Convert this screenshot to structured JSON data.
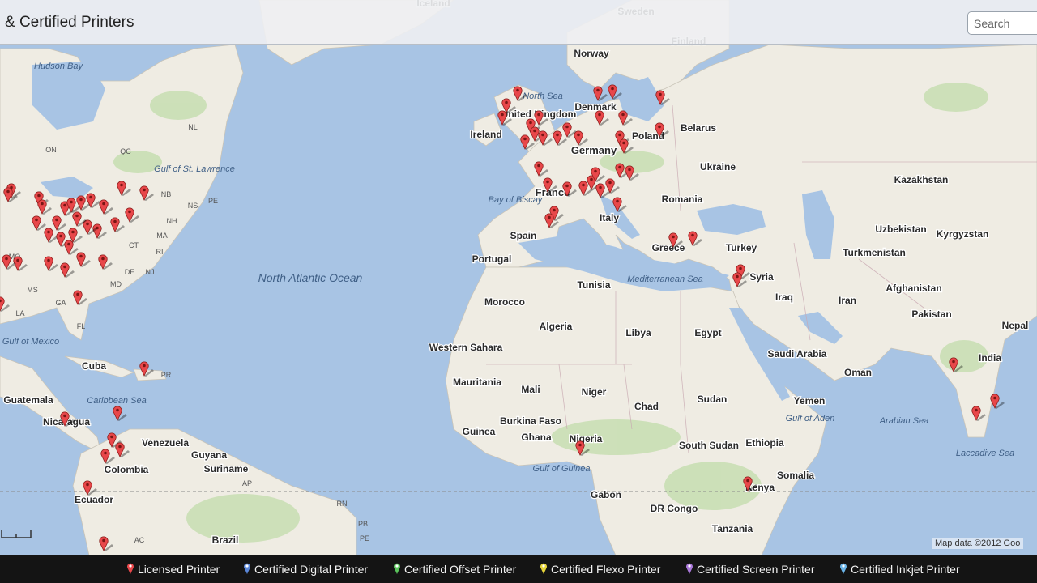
{
  "header": {
    "title": "& Certified Printers",
    "search_placeholder": "Search"
  },
  "map": {
    "attribution": "Map data ©2012 Goo",
    "country_labels": [
      "Norway",
      "Sweden",
      "Finland",
      "Iceland",
      "Denmark",
      "Ireland",
      "United Kingdom",
      "Germany",
      "Poland",
      "Belarus",
      "Ukraine",
      "France",
      "Spain",
      "Portugal",
      "Italy",
      "Romania",
      "Greece",
      "Turkey",
      "Kazakhstan",
      "Uzbekistan",
      "Kyrgyzstan",
      "Turkmenistan",
      "Afghanistan",
      "Iran",
      "Iraq",
      "Syria",
      "Pakistan",
      "India",
      "Nepal",
      "Saudi Arabia",
      "Oman",
      "Yemen",
      "Egypt",
      "Libya",
      "Algeria",
      "Tunisia",
      "Morocco",
      "Western Sahara",
      "Mauritania",
      "Mali",
      "Niger",
      "Chad",
      "Sudan",
      "South Sudan",
      "Ethiopia",
      "Somalia",
      "Kenya",
      "Tanzania",
      "DR Congo",
      "Gabon",
      "Nigeria",
      "Ghana",
      "Guinea",
      "Burkina Faso",
      "Cuba",
      "Guatemala",
      "Nicaragua",
      "Venezuela",
      "Guyana",
      "Suriname",
      "Colombia",
      "Ecuador",
      "Brazil"
    ],
    "water_labels": [
      "Hudson Bay",
      "Gulf of St. Lawrence",
      "North Atlantic Ocean",
      "Gulf of Mexico",
      "Caribbean Sea",
      "Bay of Biscay",
      "North Sea",
      "Mediterranean Sea",
      "Gulf of Guinea",
      "Gulf of Aden",
      "Arabian Sea",
      "Laccadive Sea"
    ],
    "region_labels": [
      "NL",
      "QC",
      "ON",
      "NB",
      "PE",
      "NS",
      "NH",
      "MA",
      "CT",
      "RI",
      "NJ",
      "DE",
      "MD",
      "MO",
      "MS",
      "LA",
      "GA",
      "FL",
      "PR",
      "AP",
      "AC",
      "RN",
      "PB",
      "PE"
    ]
  },
  "legend": [
    {
      "label": "Licensed Printer",
      "color": "#e8474a"
    },
    {
      "label": "Certified Digital Printer",
      "color": "#5a86d8"
    },
    {
      "label": "Certified Offset Printer",
      "color": "#59c35b"
    },
    {
      "label": "Certified Flexo Printer",
      "color": "#e6d43a"
    },
    {
      "label": "Certified Screen Printer",
      "color": "#a977d9"
    },
    {
      "label": "Certified Inkjet Printer",
      "color": "#6ab4e8"
    }
  ],
  "colors": {
    "water": "#a8c4e4",
    "land": "#efece3",
    "vegetation": "#c9dfb4",
    "marker": "#d94a45",
    "legend_bg": "#141414"
  }
}
